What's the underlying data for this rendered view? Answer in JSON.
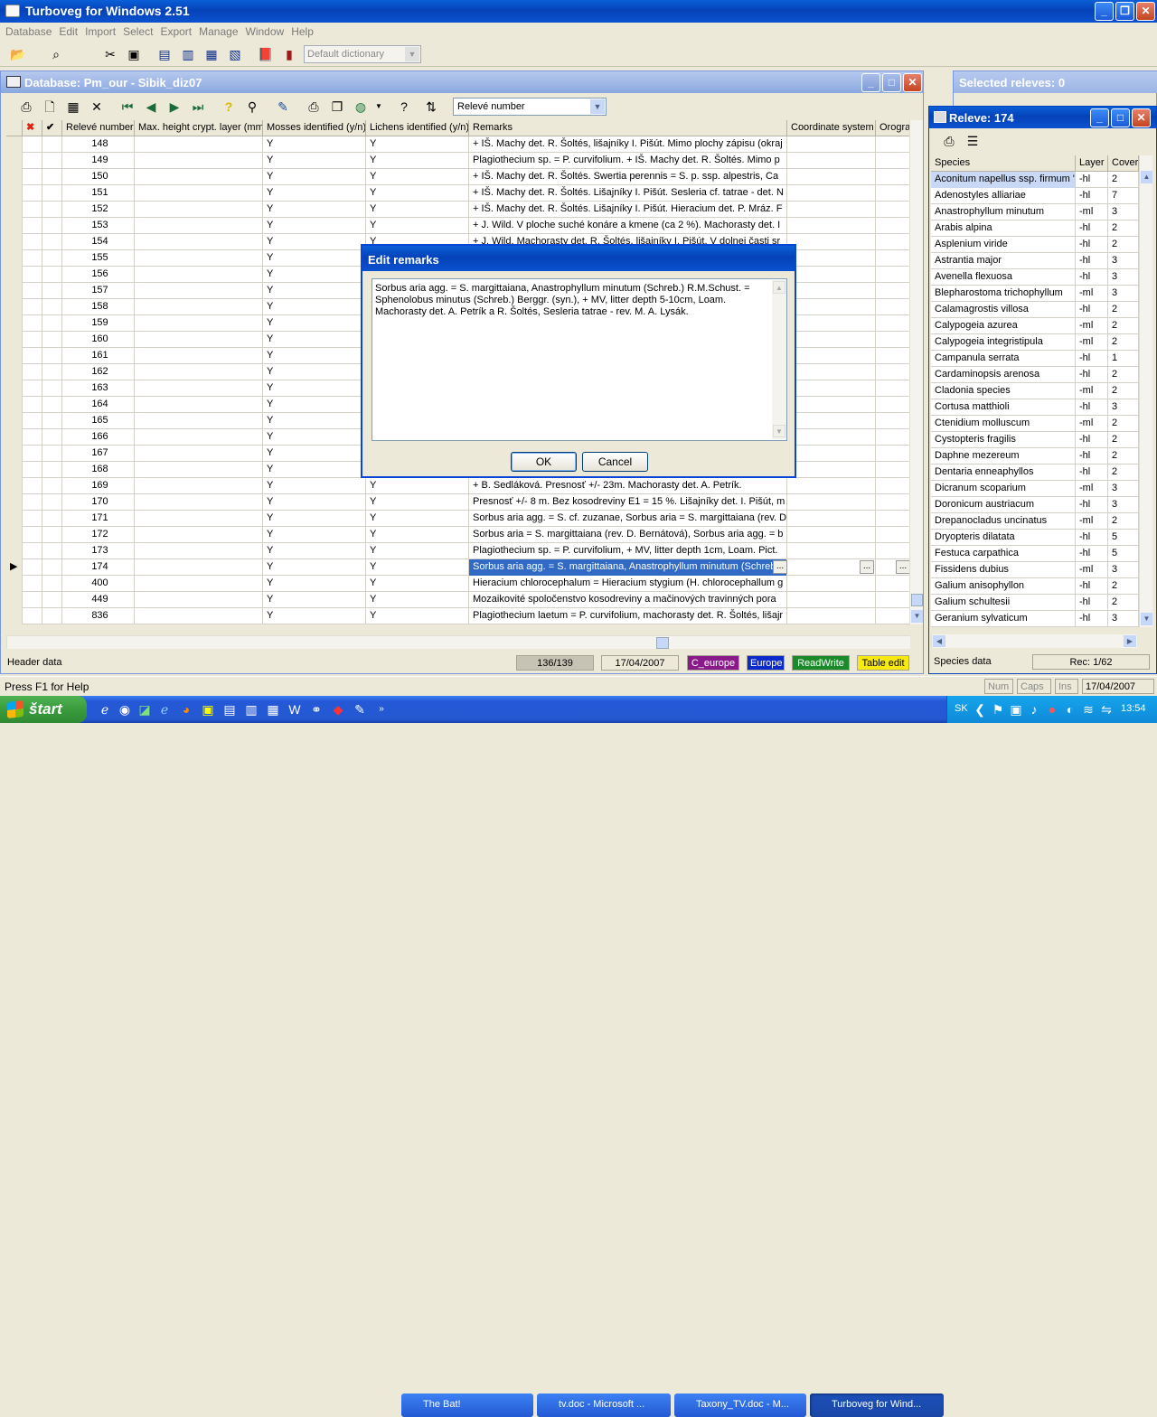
{
  "app": {
    "title": "Turboveg for Windows 2.51"
  },
  "menu": [
    "Database",
    "Edit",
    "Import",
    "Select",
    "Export",
    "Manage",
    "Window",
    "Help"
  ],
  "toolbar": {
    "dictionary": "Default dictionary"
  },
  "db_window": {
    "title": "Database: Pm_our - Sibik_diz07",
    "sort_field": "Relevé number",
    "columns": [
      "",
      "✖",
      "✔",
      "Relevé number",
      "Max. height crypt. layer (mm)",
      "Mosses identified (y/n)",
      "Lichens identified (y/n)",
      "Remarks",
      "Coordinate system",
      "Orogra"
    ],
    "rows": [
      {
        "num": "148",
        "mosses": "Y",
        "lichens": "Y",
        "remarks": "+ IŠ. Machy det. R. Šoltés, lišajníky I. Pišút. Mimo plochy zápisu (okraj"
      },
      {
        "num": "149",
        "mosses": "Y",
        "lichens": "Y",
        "remarks": "Plagiothecium sp. = P. curvifolium. + IŠ. Machy det. R. Šoltés. Mimo p"
      },
      {
        "num": "150",
        "mosses": "Y",
        "lichens": "Y",
        "remarks": "+ IŠ. Machy det. R. Šoltés.  Swertia perennis = S. p. ssp. alpestris, Ca"
      },
      {
        "num": "151",
        "mosses": "Y",
        "lichens": "Y",
        "remarks": "+ IŠ. Machy det. R. Šoltés. Lišajníky I. Pišút. Sesleria cf. tatrae - det. N"
      },
      {
        "num": "152",
        "mosses": "Y",
        "lichens": "Y",
        "remarks": "+ IŠ. Machy det. R. Šoltés. Lišajníky I. Pišút. Hieracium det. P. Mráz. F"
      },
      {
        "num": "153",
        "mosses": "Y",
        "lichens": "Y",
        "remarks": "+ J. Wild. V ploche suché konáre a kmene (ca 2 %). Machorasty det. I"
      },
      {
        "num": "154",
        "mosses": "Y",
        "lichens": "Y",
        "remarks": "+ J. Wild. Machorasty det. R. Šoltés, lišajníky I. Pišút. V dolnej časti sr"
      },
      {
        "num": "155",
        "mosses": "Y",
        "lichens": "",
        "remarks": ""
      },
      {
        "num": "156",
        "mosses": "Y",
        "lichens": "",
        "remarks": ""
      },
      {
        "num": "157",
        "mosses": "Y",
        "lichens": "",
        "remarks": ""
      },
      {
        "num": "158",
        "mosses": "Y",
        "lichens": "",
        "remarks": ""
      },
      {
        "num": "159",
        "mosses": "Y",
        "lichens": "",
        "remarks": ""
      },
      {
        "num": "160",
        "mosses": "Y",
        "lichens": "",
        "remarks": ""
      },
      {
        "num": "161",
        "mosses": "Y",
        "lichens": "",
        "remarks": ""
      },
      {
        "num": "162",
        "mosses": "Y",
        "lichens": "",
        "remarks": ""
      },
      {
        "num": "163",
        "mosses": "Y",
        "lichens": "",
        "remarks": ""
      },
      {
        "num": "164",
        "mosses": "Y",
        "lichens": "",
        "remarks": ""
      },
      {
        "num": "165",
        "mosses": "Y",
        "lichens": "",
        "remarks": ""
      },
      {
        "num": "166",
        "mosses": "Y",
        "lichens": "",
        "remarks": ""
      },
      {
        "num": "167",
        "mosses": "Y",
        "lichens": "",
        "remarks": ""
      },
      {
        "num": "168",
        "mosses": "Y",
        "lichens": "",
        "remarks": ""
      },
      {
        "num": "169",
        "mosses": "Y",
        "lichens": "Y",
        "remarks": "+ B. Sedláková. Presnosť +/- 23m. Machorasty det. A. Petrík."
      },
      {
        "num": "170",
        "mosses": "Y",
        "lichens": "Y",
        "remarks": "Presnosť +/- 8 m. Bez kosodreviny E1 = 15 %. Lišajníky det. I. Pišút, m"
      },
      {
        "num": "171",
        "mosses": "Y",
        "lichens": "Y",
        "remarks": "Sorbus aria agg. = S. cf. zuzanae, Sorbus aria = S. margittaiana (rev. D"
      },
      {
        "num": "172",
        "mosses": "Y",
        "lichens": "Y",
        "remarks": "Sorbus aria = S. margittaiana (rev. D. Bernátová), Sorbus aria agg. = b"
      },
      {
        "num": "173",
        "mosses": "Y",
        "lichens": "Y",
        "remarks": "Plagiothecium sp. = P. curvifolium, + MV, litter depth 1cm, Loam. Pict."
      },
      {
        "num": "174",
        "mosses": "Y",
        "lichens": "Y",
        "remarks": "Sorbus aria agg. = S. margittaiana, Anastrophyllum minutum (Schreb.) R"
      },
      {
        "num": "400",
        "mosses": "Y",
        "lichens": "Y",
        "remarks": "Hieracium chlorocephalum = Hieracium stygium (H. chlorocephallum g"
      },
      {
        "num": "449",
        "mosses": "Y",
        "lichens": "Y",
        "remarks": "Mozaikovité spoločenstvo kosodreviny a mačinových travinných pora"
      },
      {
        "num": "836",
        "mosses": "Y",
        "lichens": "Y",
        "remarks": "Plagiothecium laetum = P. curvifolium, machorasty det. R. Šoltés, lišajr"
      }
    ],
    "ellipsis": "...",
    "status": {
      "left": "Header data",
      "count": "136/139",
      "date": "17/04/2007",
      "c_europe": "C_europe",
      "europe": "Europe",
      "rw": "ReadWrite",
      "mode": "Table edit"
    }
  },
  "dialog": {
    "title": "Edit remarks",
    "text": "Sorbus aria agg. = S. margittaiana, Anastrophyllum minutum (Schreb.) R.M.Schust. = Sphenolobus minutus (Schreb.) Berggr. (syn.), + MV, litter depth 5-10cm, Loam. Machorasty det. A. Petrík a R. Šoltés, Sesleria tatrae - rev. M. A. Lysák.",
    "ok": "OK",
    "cancel": "Cancel"
  },
  "selected_window": {
    "title": "Selected releves: 0"
  },
  "releve_window": {
    "title": "Releve: 174",
    "columns": [
      "Species",
      "Layer",
      "Cover"
    ],
    "rows": [
      [
        "Aconitum napellus ssp. firmum \"n",
        "-hl",
        "2"
      ],
      [
        "Adenostyles alliariae",
        "-hl",
        "7"
      ],
      [
        "Anastrophyllum minutum",
        "-ml",
        "3"
      ],
      [
        "Arabis alpina",
        "-hl",
        "2"
      ],
      [
        "Asplenium viride",
        "-hl",
        "2"
      ],
      [
        "Astrantia major",
        "-hl",
        "3"
      ],
      [
        "Avenella flexuosa",
        "-hl",
        "3"
      ],
      [
        "Blepharostoma trichophyllum",
        "-ml",
        "3"
      ],
      [
        "Calamagrostis villosa",
        "-hl",
        "2"
      ],
      [
        "Calypogeia azurea",
        "-ml",
        "2"
      ],
      [
        "Calypogeia integristipula",
        "-ml",
        "2"
      ],
      [
        "Campanula serrata",
        "-hl",
        "1"
      ],
      [
        "Cardaminopsis arenosa",
        "-hl",
        "2"
      ],
      [
        "Cladonia species",
        "-ml",
        "2"
      ],
      [
        "Cortusa matthioli",
        "-hl",
        "3"
      ],
      [
        "Ctenidium molluscum",
        "-ml",
        "2"
      ],
      [
        "Cystopteris fragilis",
        "-hl",
        "2"
      ],
      [
        "Daphne mezereum",
        "-hl",
        "2"
      ],
      [
        "Dentaria enneaphyllos",
        "-hl",
        "2"
      ],
      [
        "Dicranum scoparium",
        "-ml",
        "3"
      ],
      [
        "Doronicum austriacum",
        "-hl",
        "3"
      ],
      [
        "Drepanocladus uncinatus",
        "-ml",
        "2"
      ],
      [
        "Dryopteris dilatata",
        "-hl",
        "5"
      ],
      [
        "Festuca carpathica",
        "-hl",
        "5"
      ],
      [
        "Fissidens dubius",
        "-ml",
        "3"
      ],
      [
        "Galium anisophyllon",
        "-hl",
        "2"
      ],
      [
        "Galium schultesii",
        "-hl",
        "2"
      ],
      [
        "Geranium sylvaticum",
        "-hl",
        "3"
      ]
    ],
    "status": {
      "left": "Species data",
      "rec": "Rec: 1/62"
    }
  },
  "bottom_status": {
    "help": "Press F1 for Help",
    "num": "Num",
    "caps": "Caps",
    "ins": "Ins",
    "date": "17/04/2007"
  },
  "taskbar": {
    "start": "štart",
    "tasks": [
      "The Bat!",
      "tv.doc - Microsoft ...",
      "Taxony_TV.doc - M...",
      "Turboveg for Wind..."
    ],
    "lang": "SK",
    "clock": "13:54"
  }
}
